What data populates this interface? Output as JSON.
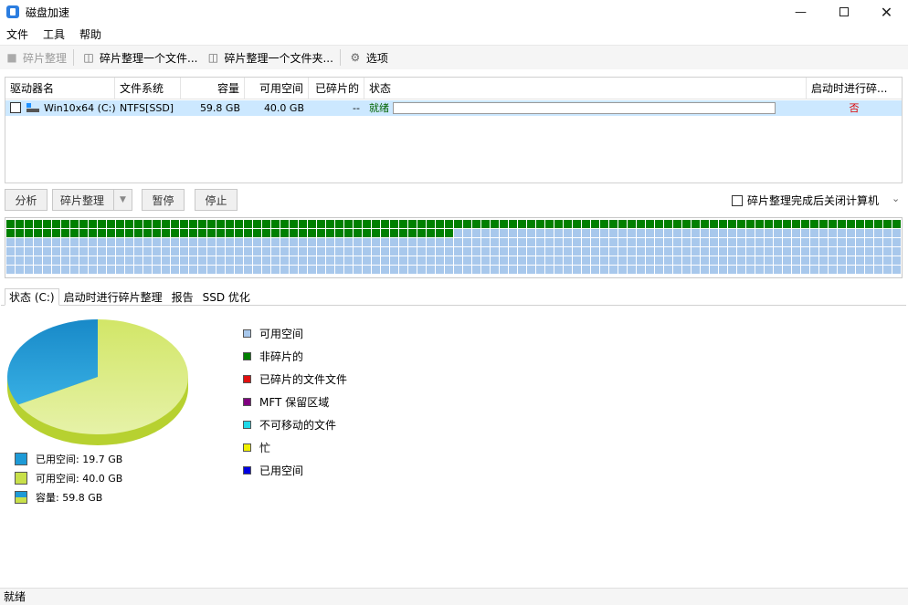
{
  "window": {
    "title": "磁盘加速",
    "minimize_icon": "minimize-icon",
    "maximize_icon": "maximize-icon",
    "close_icon": "close-icon"
  },
  "menu": {
    "items": [
      "文件",
      "工具",
      "帮助"
    ]
  },
  "toolbar": {
    "defrag_label": "碎片整理",
    "defrag_file_label": "碎片整理一个文件...",
    "defrag_folder_label": "碎片整理一个文件夹...",
    "options_label": "选项"
  },
  "drive_list": {
    "columns": [
      "驱动器名",
      "文件系统",
      "容量",
      "可用空间",
      "已碎片的",
      "状态",
      "启动时进行碎..."
    ],
    "rows": [
      {
        "name": "Win10x64 (C:)",
        "filesystem": "NTFS[SSD]",
        "capacity": "59.8 GB",
        "free": "40.0 GB",
        "fragmented": "--",
        "status": "就绪",
        "progress": 0,
        "boot_defrag": "否"
      }
    ]
  },
  "actions": {
    "analyze_label": "分析",
    "defrag_label": "碎片整理",
    "pause_label": "暂停",
    "stop_label": "停止",
    "shutdown_label": "碎片整理完成后关闭计算机",
    "shutdown_checked": false
  },
  "cluster_map": {
    "cols": 98,
    "rows": 6,
    "used_cells": 147,
    "used_color": "#008000",
    "free_color": "#a8c8ec"
  },
  "tabs": [
    "状态 (C:)",
    "启动时进行碎片整理",
    "报告",
    "SSD 优化"
  ],
  "pie": {
    "used_gb": 19.7,
    "free_gb": 40.0,
    "used_color": "#1e9ad6",
    "free_color": "#c8e04a"
  },
  "legend_left": [
    {
      "label": "已用空间: 19.7 GB",
      "color": "#1e9ad6"
    },
    {
      "label": "可用空间: 40.0 GB",
      "color": "#c8e04a"
    },
    {
      "label": "容量: 59.8 GB",
      "color": "split"
    }
  ],
  "legend_right": [
    {
      "label": "可用空间",
      "color": "#a8c8ec"
    },
    {
      "label": "非碎片的",
      "color": "#008000"
    },
    {
      "label": "已碎片的文件文件",
      "color": "#e01010"
    },
    {
      "label": "MFT 保留区域",
      "color": "#800080"
    },
    {
      "label": "不可移动的文件",
      "color": "#20d8e8"
    },
    {
      "label": "忙",
      "color": "#f0f000"
    },
    {
      "label": "已用空间",
      "color": "#0000e0"
    }
  ],
  "statusbar": {
    "text": "就绪"
  }
}
